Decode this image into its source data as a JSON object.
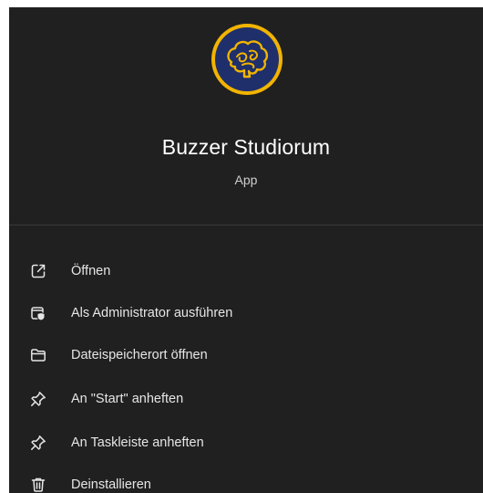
{
  "app": {
    "name": "Buzzer Studiorum",
    "type": "App",
    "logo_colors": {
      "ring": "#f2b400",
      "fill": "#1f2f6b",
      "brain": "#f2b400"
    }
  },
  "menu": {
    "items": [
      {
        "label": "Öffnen",
        "icon": "open-external-icon"
      },
      {
        "label": "Als Administrator ausführen",
        "icon": "run-as-admin-shield-icon"
      },
      {
        "label": "Dateispeicherort öffnen",
        "icon": "folder-icon"
      },
      {
        "label": "An \"Start\" anheften",
        "icon": "pin-icon"
      },
      {
        "label": "An Taskleiste anheften",
        "icon": "pin-icon"
      },
      {
        "label": "Deinstallieren",
        "icon": "trash-icon"
      }
    ]
  },
  "colors": {
    "panel_bg": "#202020",
    "text_primary": "#ffffff",
    "text_secondary": "#cfcfcf"
  }
}
